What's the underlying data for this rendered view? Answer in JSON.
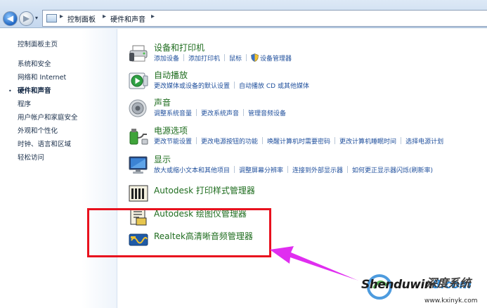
{
  "breadcrumb": {
    "items": [
      "控制面板",
      "硬件和声音"
    ],
    "separator": "▸",
    "dropdown": "▾"
  },
  "nav_buttons": {
    "back": "◀",
    "forward": "▶"
  },
  "left_nav": {
    "home": "控制面板主页",
    "bullet": "•",
    "items": [
      "系统和安全",
      "网络和 Internet",
      "硬件和声音",
      "程序",
      "用户帐户和家庭安全",
      "外观和个性化",
      "时钟、语言和区域",
      "轻松访问"
    ],
    "selected_index": 2
  },
  "categories": [
    {
      "icon": "devices-printers-icon",
      "title": "设备和打印机",
      "links": [
        "添加设备",
        "添加打印机",
        "鼠标",
        "设备管理器"
      ],
      "shield_on_link": 3
    },
    {
      "icon": "autoplay-icon",
      "title": "自动播放",
      "links": [
        "更改媒体或设备的默认设置",
        "自动播放 CD 或其他媒体"
      ]
    },
    {
      "icon": "speaker-icon",
      "title": "声音",
      "links": [
        "调整系统音量",
        "更改系统声音",
        "管理音频设备"
      ]
    },
    {
      "icon": "power-icon",
      "title": "电源选项",
      "links": [
        "更改节能设置",
        "更改电源按钮的功能",
        "唤醒计算机时需要密码",
        "更改计算机睡眠时间",
        "选择电源计划"
      ]
    },
    {
      "icon": "display-icon",
      "title": "显示",
      "links": [
        "放大或缩小文本和其他项目",
        "调整屏幕分辨率",
        "连接到外部显示器",
        "如何更正显示器闪烁(刷新率)"
      ]
    }
  ],
  "vendor_items": [
    {
      "icon": "autodesk-print-style-icon",
      "title": "Autodesk 打印样式管理器"
    },
    {
      "icon": "autodesk-plotter-icon",
      "title": "Autodesk 绘图仪管理器"
    },
    {
      "icon": "realtek-audio-icon",
      "title": "Realtek高清晰音频管理器"
    }
  ],
  "annotation": {
    "box_color": "#e8111e",
    "arrow_color": "#e02ef0"
  },
  "watermark": {
    "brand_main": "Shenduwin",
    "brand_accent": "8.com",
    "chinese": "深度系统",
    "url": "www.kxinyk.com"
  },
  "colors": {
    "title_green": "#1e6c1e",
    "link_blue": "#1f4f9c",
    "nav_text": "#1a2f4a"
  }
}
